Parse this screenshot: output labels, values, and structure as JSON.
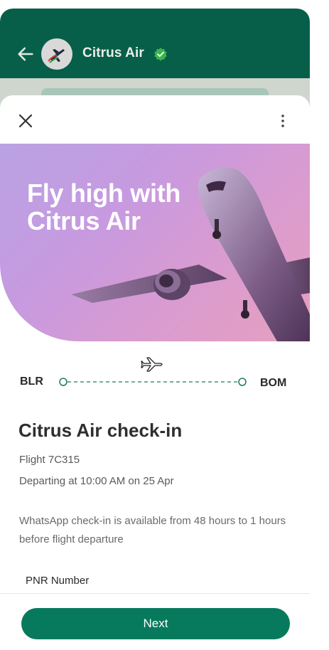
{
  "chat": {
    "title": "Citrus Air",
    "verified_icon": "verified-check-icon",
    "back_icon": "arrow-left-icon",
    "header_color": "#075e49"
  },
  "sheet": {
    "close_icon": "close-icon",
    "more_icon": "more-vertical-icon",
    "hero_title": "Fly high with Citrus Air",
    "route": {
      "from": "BLR",
      "to": "BOM",
      "icon": "airplane-outline-icon"
    },
    "checkin_title": "Citrus Air check-in",
    "flight": "Flight 7C315",
    "departing": "Departing at 10:00 AM on 25 Apr",
    "notice": "WhatsApp check-in is available from 48 hours to 1 hours before flight departure",
    "pnr_label": "PNR Number",
    "next_label": "Next",
    "accent": "#077a5d"
  }
}
